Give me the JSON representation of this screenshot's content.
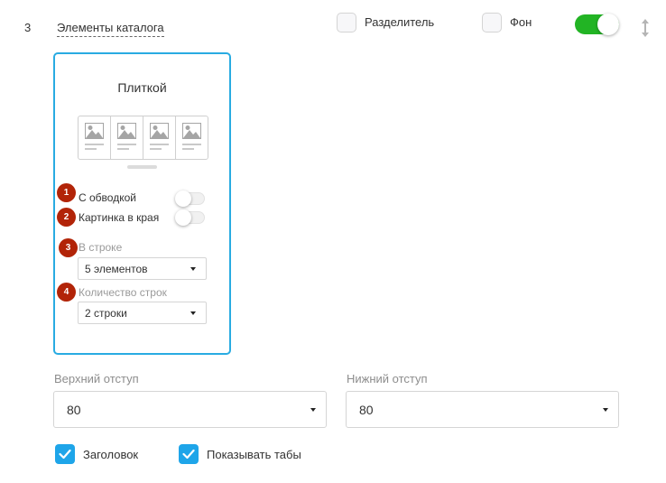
{
  "section": {
    "number": "3",
    "title": "Элементы каталога"
  },
  "header_options": {
    "divider_label": "Разделитель",
    "divider_checked": false,
    "background_label": "Фон",
    "background_checked": false,
    "enabled": true
  },
  "card": {
    "title": "Плиткой",
    "options": [
      {
        "badge": "1",
        "label": "С обводкой",
        "on": false
      },
      {
        "badge": "2",
        "label": "Картинка в края",
        "on": false
      }
    ],
    "per_row": {
      "badge": "3",
      "label": "В строке",
      "value": "5 элементов"
    },
    "rows_count": {
      "badge": "4",
      "label": "Количество строк",
      "value": "2 строки"
    }
  },
  "padding": {
    "top_label": "Верхний отступ",
    "top_value": "80",
    "bottom_label": "Нижний отступ",
    "bottom_value": "80"
  },
  "checkboxes": {
    "heading_label": "Заголовок",
    "heading_checked": true,
    "tabs_label": "Показывать табы",
    "tabs_checked": true
  },
  "colors": {
    "accent_blue": "#29abe2",
    "toggle_green": "#22b424",
    "badge_red": "#b22408"
  }
}
